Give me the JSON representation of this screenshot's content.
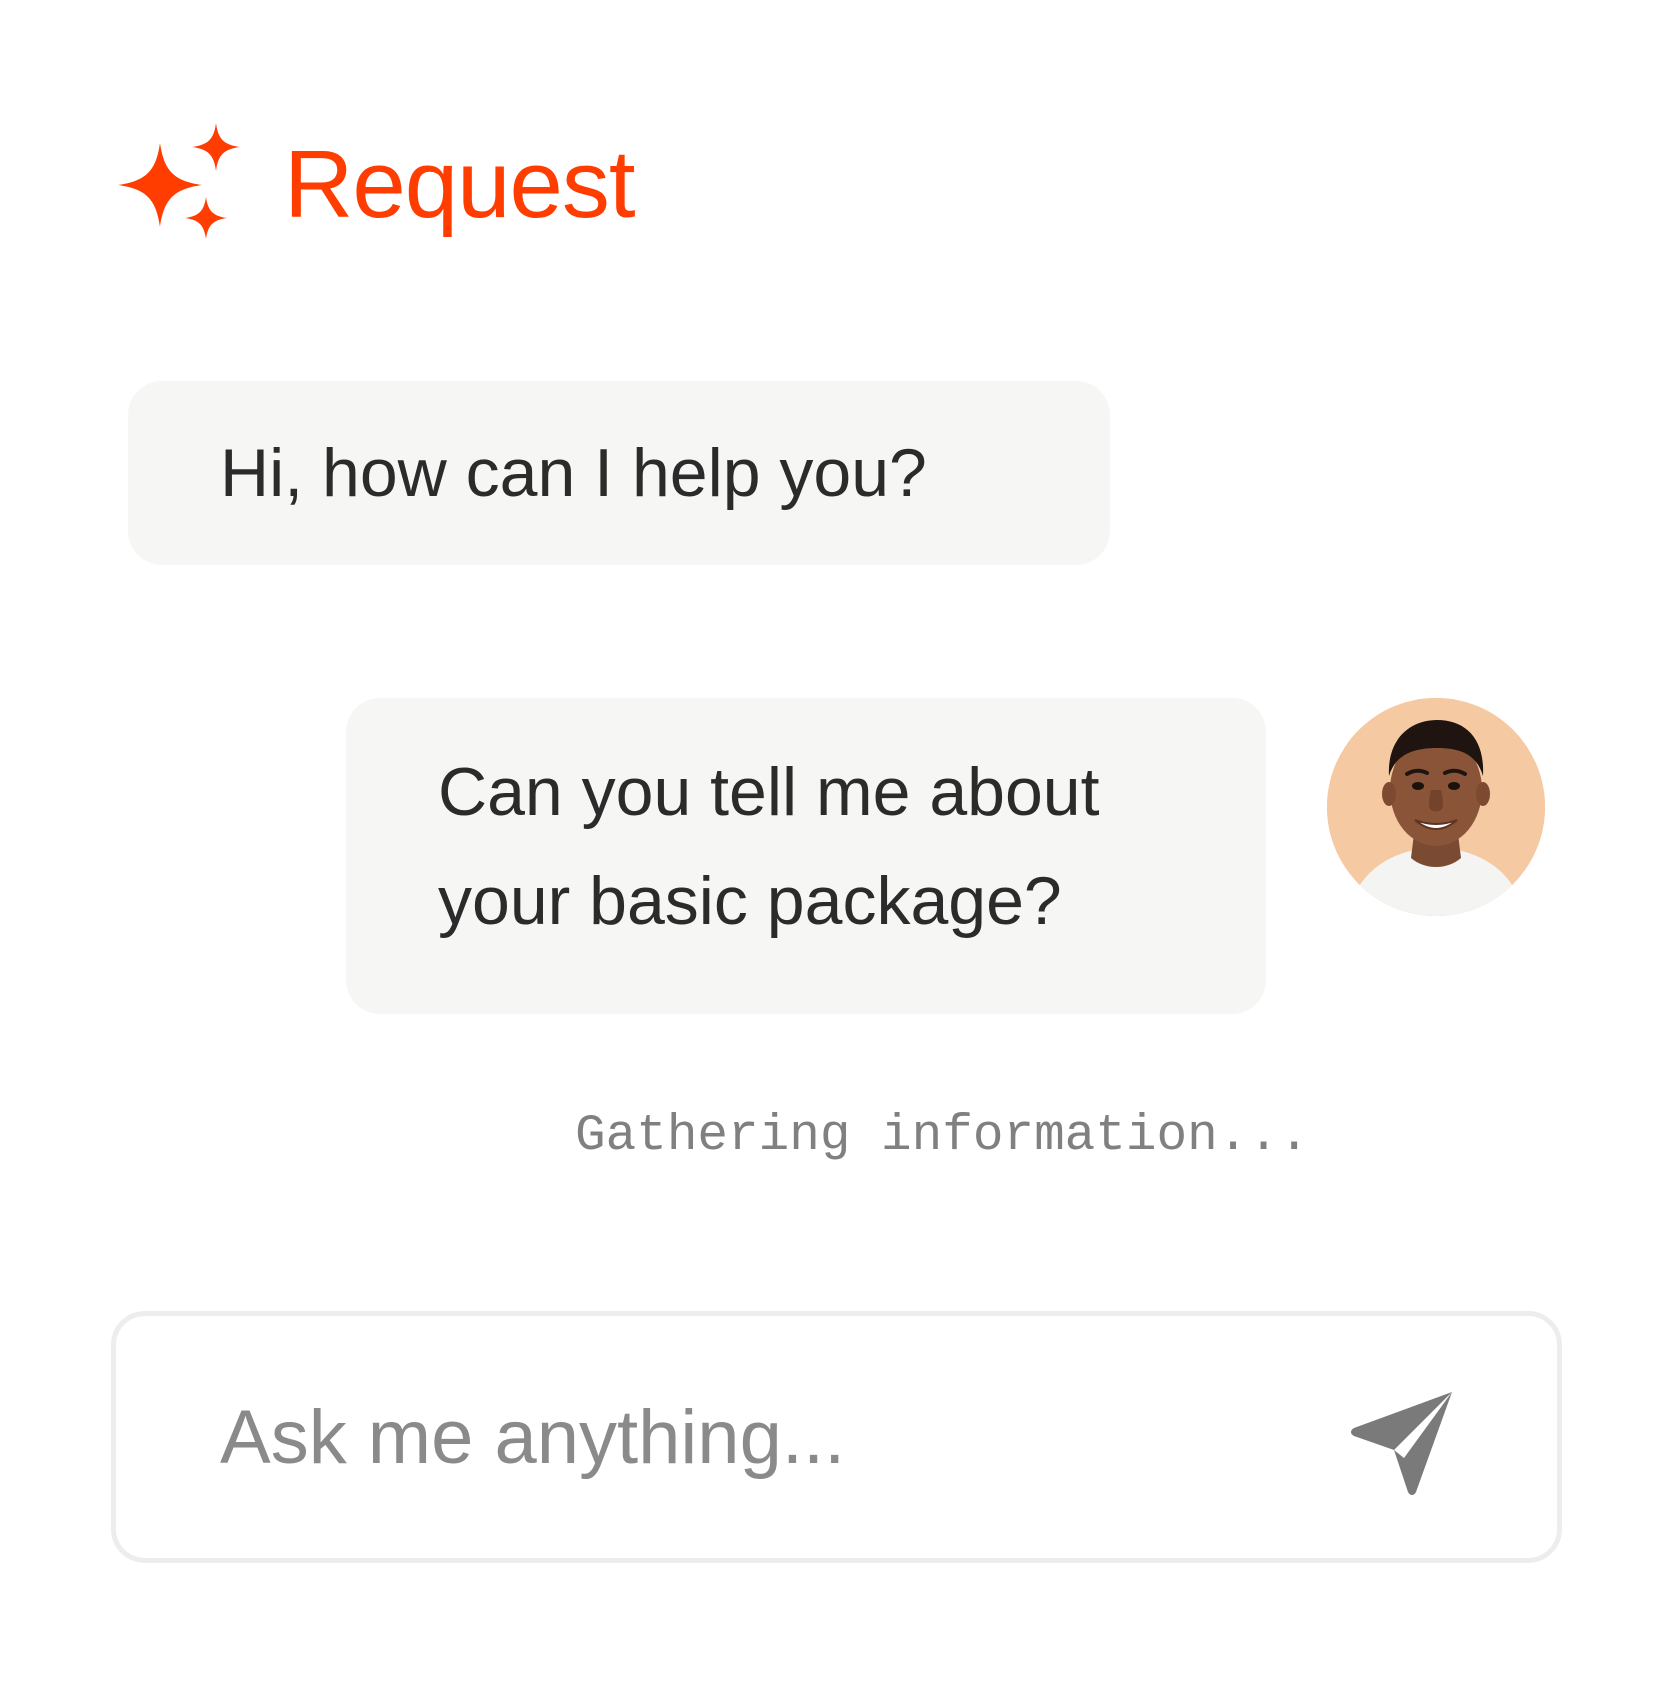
{
  "header": {
    "title": "Request",
    "icon": "sparkle-icon",
    "accent_color": "#ff3d00"
  },
  "messages": [
    {
      "role": "assistant",
      "lines": [
        "Hi, how can I help you?"
      ]
    },
    {
      "role": "user",
      "lines": [
        "Can you tell me about",
        "your basic package?"
      ],
      "avatar": "user-avatar"
    }
  ],
  "status": {
    "text": "Gathering information..."
  },
  "composer": {
    "placeholder": "Ask me anything...",
    "value": "",
    "send_icon": "send-icon"
  },
  "colors": {
    "bubble_bg": "#f6f6f4",
    "text": "#2b2b2b",
    "muted": "#8a8a8a"
  }
}
